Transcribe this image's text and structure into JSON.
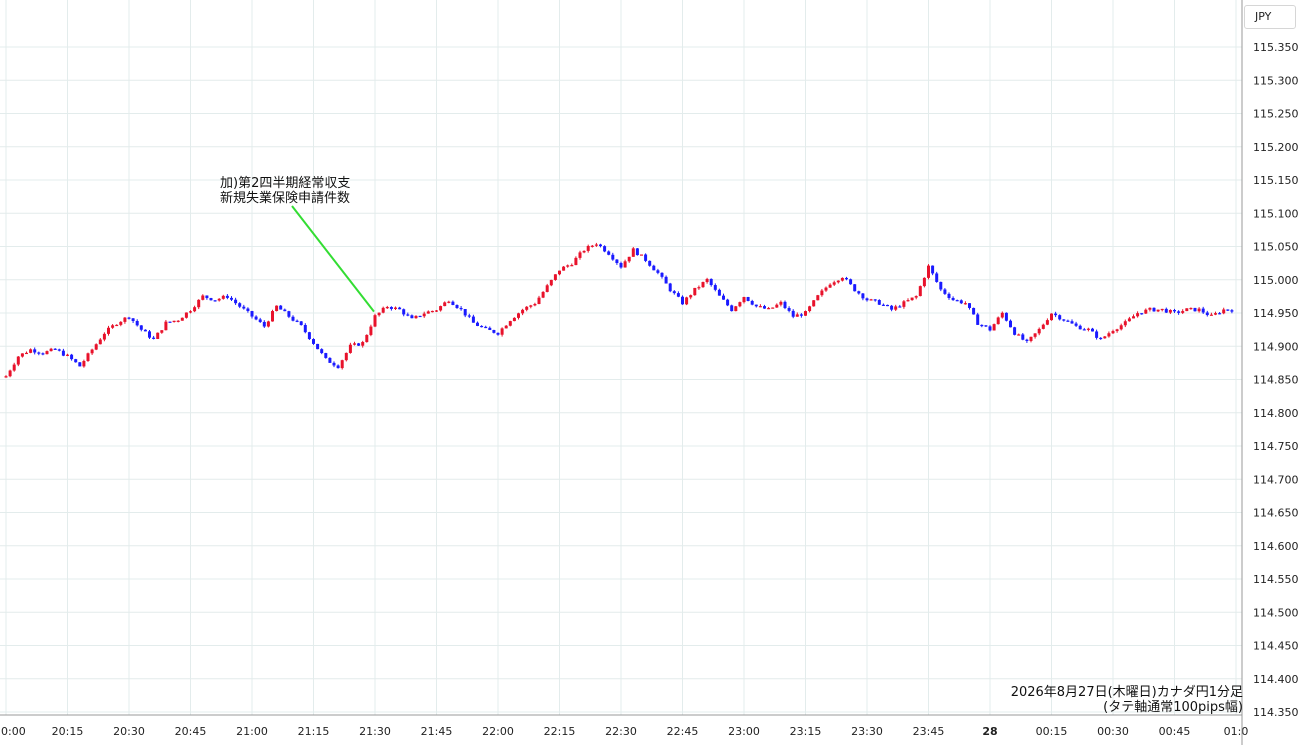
{
  "currency_label": "JPY",
  "caption": {
    "line1": "2026年8月27日(木曜日)カナダ円1分足",
    "line2": "(タテ軸通常100pips幅)"
  },
  "annotation": {
    "line1": "加)第2四半期経常収支",
    "line2": "新規失業保険申請件数",
    "time": "21:30",
    "price": 114.952,
    "line_color": "#33dd33"
  },
  "colors": {
    "up": "#e8122b",
    "down": "#1a1aff",
    "grid": "#e3ecec",
    "axis": "#999999"
  },
  "chart_data": {
    "type": "candlestick",
    "title": "",
    "x_label": "",
    "y_label": "",
    "y_range": [
      114.35,
      115.38
    ],
    "y_ticks": [
      "115.350",
      "115.300",
      "115.250",
      "115.200",
      "115.150",
      "115.100",
      "115.050",
      "115.000",
      "114.950",
      "114.900",
      "114.850",
      "114.800",
      "114.750",
      "114.700",
      "114.650",
      "114.600",
      "114.550",
      "114.500",
      "114.450",
      "114.400",
      "114.350"
    ],
    "x_tick_labels": [
      "0:00",
      "20:15",
      "20:30",
      "20:45",
      "21:00",
      "21:15",
      "21:30",
      "21:45",
      "22:00",
      "22:15",
      "22:30",
      "22:45",
      "23:00",
      "23:15",
      "23:30",
      "23:45",
      "28",
      "00:15",
      "00:30",
      "00:45",
      "01:0"
    ],
    "close_path": [
      [
        "20:00",
        114.855
      ],
      [
        "20:03",
        114.885
      ],
      [
        "20:06",
        114.895
      ],
      [
        "20:09",
        114.89
      ],
      [
        "20:12",
        114.895
      ],
      [
        "20:15",
        114.885
      ],
      [
        "20:18",
        114.87
      ],
      [
        "20:21",
        114.895
      ],
      [
        "20:24",
        114.92
      ],
      [
        "20:27",
        114.935
      ],
      [
        "20:30",
        114.945
      ],
      [
        "20:33",
        114.925
      ],
      [
        "20:36",
        114.91
      ],
      [
        "20:39",
        114.935
      ],
      [
        "20:42",
        114.94
      ],
      [
        "20:45",
        114.955
      ],
      [
        "20:48",
        114.975
      ],
      [
        "20:51",
        114.97
      ],
      [
        "20:54",
        114.975
      ],
      [
        "20:57",
        114.96
      ],
      [
        "21:00",
        114.945
      ],
      [
        "21:03",
        114.93
      ],
      [
        "21:06",
        114.96
      ],
      [
        "21:09",
        114.945
      ],
      [
        "21:12",
        114.93
      ],
      [
        "21:15",
        114.905
      ],
      [
        "21:18",
        114.88
      ],
      [
        "21:21",
        114.87
      ],
      [
        "21:24",
        114.9
      ],
      [
        "21:27",
        114.905
      ],
      [
        "21:30",
        114.945
      ],
      [
        "21:33",
        114.96
      ],
      [
        "21:36",
        114.955
      ],
      [
        "21:39",
        114.94
      ],
      [
        "21:42",
        114.95
      ],
      [
        "21:45",
        114.955
      ],
      [
        "21:48",
        114.97
      ],
      [
        "21:51",
        114.955
      ],
      [
        "21:54",
        114.935
      ],
      [
        "21:57",
        114.925
      ],
      [
        "22:00",
        114.92
      ],
      [
        "22:03",
        114.94
      ],
      [
        "22:06",
        114.955
      ],
      [
        "22:09",
        114.965
      ],
      [
        "22:12",
        114.99
      ],
      [
        "22:15",
        115.015
      ],
      [
        "22:18",
        115.025
      ],
      [
        "22:21",
        115.045
      ],
      [
        "22:24",
        115.055
      ],
      [
        "22:27",
        115.04
      ],
      [
        "22:30",
        115.02
      ],
      [
        "22:33",
        115.045
      ],
      [
        "22:36",
        115.03
      ],
      [
        "22:39",
        115.01
      ],
      [
        "22:42",
        114.985
      ],
      [
        "22:45",
        114.965
      ],
      [
        "22:48",
        114.985
      ],
      [
        "22:51",
        115.0
      ],
      [
        "22:54",
        114.975
      ],
      [
        "22:57",
        114.955
      ],
      [
        "23:00",
        114.975
      ],
      [
        "23:03",
        114.96
      ],
      [
        "23:06",
        114.955
      ],
      [
        "23:09",
        114.965
      ],
      [
        "23:12",
        114.945
      ],
      [
        "23:15",
        114.95
      ],
      [
        "23:18",
        114.975
      ],
      [
        "23:21",
        114.995
      ],
      [
        "23:24",
        115.005
      ],
      [
        "23:27",
        114.985
      ],
      [
        "23:30",
        114.97
      ],
      [
        "23:33",
        114.965
      ],
      [
        "23:36",
        114.955
      ],
      [
        "23:39",
        114.965
      ],
      [
        "23:42",
        114.975
      ],
      [
        "23:45",
        115.02
      ],
      [
        "23:48",
        114.985
      ],
      [
        "23:51",
        114.97
      ],
      [
        "23:54",
        114.965
      ],
      [
        "23:57",
        114.935
      ],
      [
        "00:00",
        114.925
      ],
      [
        "00:03",
        114.95
      ],
      [
        "00:06",
        114.92
      ],
      [
        "00:09",
        114.905
      ],
      [
        "00:12",
        114.925
      ],
      [
        "00:15",
        114.95
      ],
      [
        "00:18",
        114.94
      ],
      [
        "00:21",
        114.93
      ],
      [
        "00:24",
        114.925
      ],
      [
        "00:27",
        114.91
      ],
      [
        "00:30",
        114.925
      ],
      [
        "00:33",
        114.935
      ],
      [
        "00:36",
        114.95
      ],
      [
        "00:39",
        114.955
      ],
      [
        "00:42",
        114.955
      ],
      [
        "00:45",
        114.95
      ],
      [
        "00:48",
        114.955
      ],
      [
        "00:51",
        114.955
      ],
      [
        "00:54",
        114.945
      ],
      [
        "00:57",
        114.955
      ]
    ]
  }
}
